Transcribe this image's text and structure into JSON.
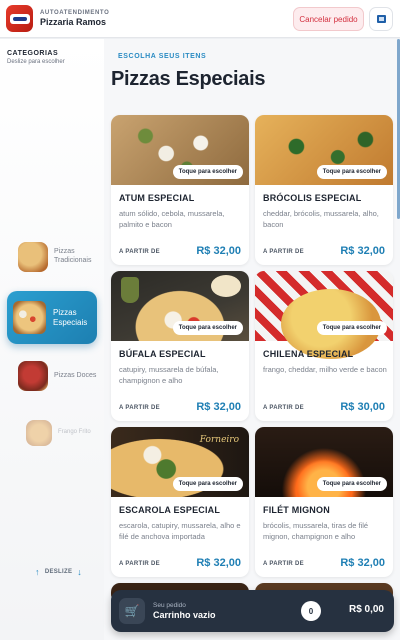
{
  "header": {
    "kicker": "AUTOATENDIMENTO",
    "store_name": "Pizzaria Ramos",
    "cancel_label": "Cancelar pedido",
    "language_icon": "flag-icon"
  },
  "sidebar": {
    "title": "CATEGORIAS",
    "subtitle": "Deslize para escolher",
    "items": [
      {
        "label": "Pizzas Tradicionais",
        "active": false
      },
      {
        "label": "Pizzas Especiais",
        "active": true
      },
      {
        "label": "Pizzas Doces",
        "active": false
      },
      {
        "label": "Frango Frito",
        "active": false
      }
    ],
    "scroll_hint": "DESLIZE"
  },
  "main": {
    "kicker": "ESCOLHA SEUS ITENS",
    "title": "Pizzas Especiais",
    "tap_label": "Toque para escolher",
    "from_label": "A PARTIR DE",
    "products": [
      {
        "name": "ATUM ESPECIAL",
        "description": "atum sólido, cebola, mussarela, palmito e bacon",
        "price": "R$ 32,00"
      },
      {
        "name": "BRÓCOLIS ESPECIAL",
        "description": "cheddar, brócolis, mussarela, alho, bacon",
        "price": "R$ 32,00"
      },
      {
        "name": "BÚFALA ESPECIAL",
        "description": "catupiry, mussarela de búfala, champignon e alho",
        "price": "R$ 32,00"
      },
      {
        "name": "CHILENA ESPECIAL",
        "description": "frango, cheddar, milho verde e bacon",
        "price": "R$ 30,00"
      },
      {
        "name": "ESCAROLA ESPECIAL",
        "description": "escarola, catupiry, mussarela, alho e filé de anchova importada",
        "price": "R$ 32,00"
      },
      {
        "name": "FILÉT MIGNON",
        "description": "brócolis, mussarela, tiras de filé mignon, champignon e alho",
        "price": "R$ 32,00"
      }
    ],
    "image_brand_text": "Forneiro"
  },
  "cart": {
    "label": "Seu pedido",
    "status": "Carrinho vazio",
    "count": "0",
    "total": "R$ 0,00"
  },
  "colors": {
    "accent": "#2a8bc3",
    "cancel": "#d3303f",
    "cart_bg": "#263140"
  }
}
